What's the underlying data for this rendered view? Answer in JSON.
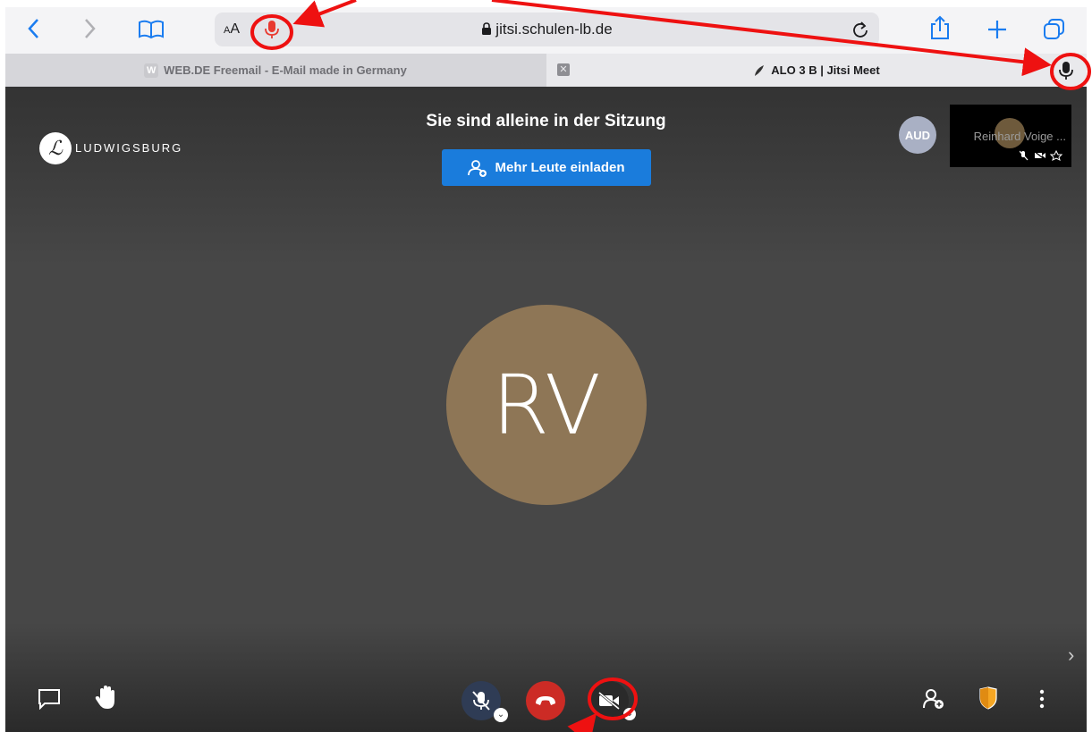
{
  "browser": {
    "address_text_size_label_small": "A",
    "address_text_size_label_large": "A",
    "url": "jitsi.schulen-lb.de",
    "tabs": [
      {
        "favicon": "W",
        "title": "WEB.DE Freemail - E-Mail made in Germany"
      },
      {
        "title": "ALO 3 B | Jitsi Meet"
      }
    ],
    "tab_close_glyph": "✕"
  },
  "meeting": {
    "status_title": "Sie sind alleine in der Sitzung",
    "invite_label": "Mehr Leute einladen",
    "brand_initial": "ℒ",
    "brand_name": "LUDWIGSBURG",
    "main_avatar_initials": "RV",
    "audio_avatar_label": "AUD",
    "thumbnail_name": "Reinhard Voige ...",
    "side_expand_glyph": "›"
  },
  "colors": {
    "accent_blue": "#1a7cdc",
    "hangup_red": "#cc2b25",
    "mic_button": "#2f3c55",
    "avatar_brown": "#8e7656",
    "annotation_red": "#ee1111",
    "moderator_orange": "#f5a623"
  },
  "icons": [
    "back-icon",
    "forward-icon",
    "bookmarks-icon",
    "microphone-icon",
    "lock-icon",
    "reload-icon",
    "share-icon",
    "new-tab-icon",
    "tabs-overview-icon",
    "chat-icon",
    "raise-hand-icon",
    "microphone-muted-icon",
    "hangup-icon",
    "camera-off-icon",
    "invite-icon",
    "security-shield-icon",
    "more-icon"
  ]
}
